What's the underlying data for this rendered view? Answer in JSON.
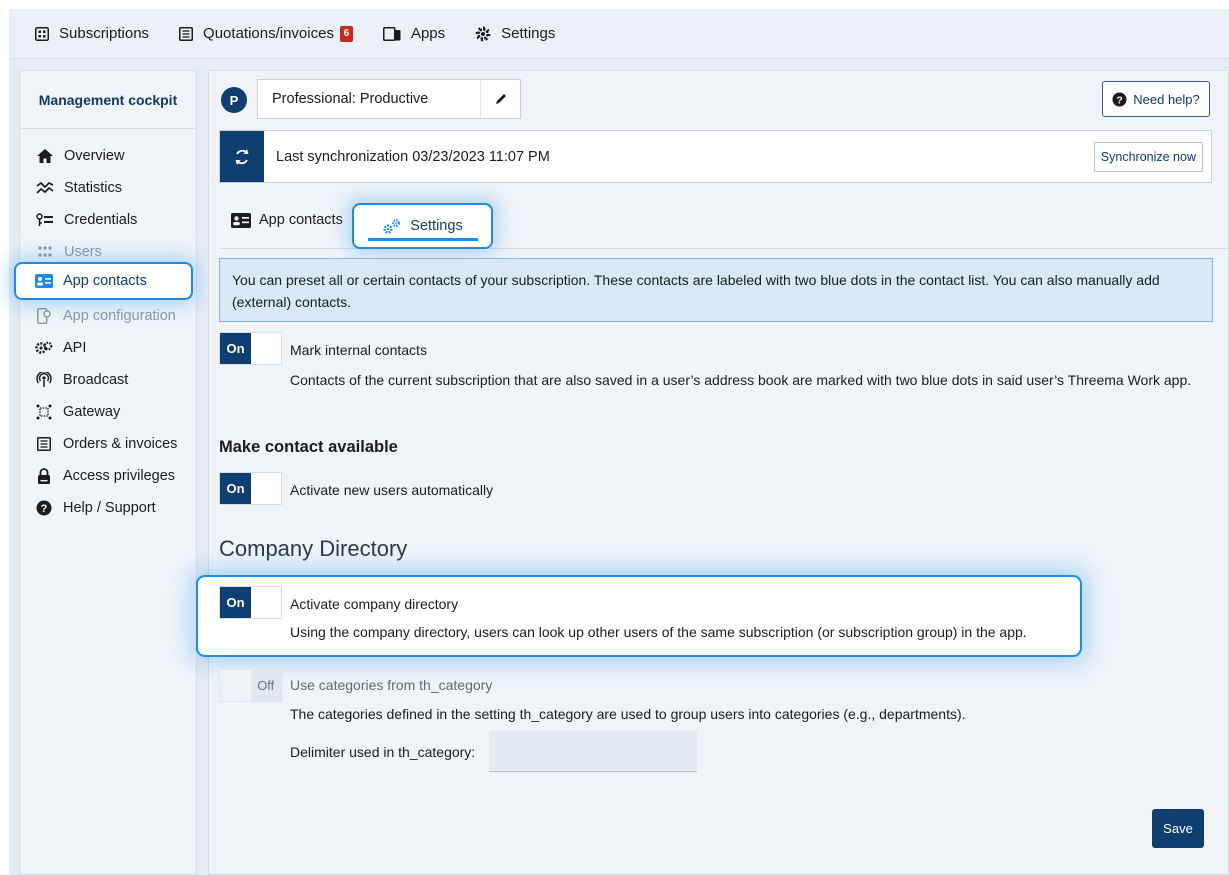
{
  "topnav": {
    "items": [
      {
        "label": "Subscriptions",
        "icon": "grid-icon"
      },
      {
        "label": "Quotations/invoices",
        "icon": "invoice-icon",
        "badge": "6"
      },
      {
        "label": "Apps",
        "icon": "apps-icon"
      },
      {
        "label": "Settings",
        "icon": "gear-icon"
      }
    ]
  },
  "sidebar": {
    "title": "Management cockpit",
    "items": [
      {
        "label": "Overview",
        "icon": "home-icon"
      },
      {
        "label": "Statistics",
        "icon": "chart-icon"
      },
      {
        "label": "Credentials",
        "icon": "key-icon"
      },
      {
        "label": "Users",
        "icon": "users-icon",
        "disabled": true
      },
      {
        "label": "App contacts",
        "icon": "contacts-icon",
        "active": true
      },
      {
        "label": "App configuration",
        "icon": "app-config-icon",
        "disabled": true
      },
      {
        "label": "API",
        "icon": "api-icon"
      },
      {
        "label": "Broadcast",
        "icon": "broadcast-icon"
      },
      {
        "label": "Gateway",
        "icon": "gateway-icon"
      },
      {
        "label": "Orders & invoices",
        "icon": "orders-icon"
      },
      {
        "label": "Access privileges",
        "icon": "lock-icon"
      },
      {
        "label": "Help / Support",
        "icon": "help-icon"
      }
    ]
  },
  "header": {
    "profile_initial": "P",
    "profile_name": "Professional: Productive",
    "help_label": "Need help?",
    "sync_text": "Last synchronization 03/23/2023 11:07 PM",
    "sync_button": "Synchronize now"
  },
  "tabs": {
    "app_contacts": "App contacts",
    "settings": "Settings"
  },
  "info": {
    "text": "You can preset all or certain contacts of your subscription. These contacts are labeled with two blue dots in the contact list. You can also manually add (external) contacts."
  },
  "settings": {
    "mark_internal": {
      "state": "On",
      "label": "Mark internal contacts",
      "desc": "Contacts of the current subscription that are also saved in a user’s address book are marked with two blue dots in said user’s Threema Work app."
    },
    "make_available_heading": "Make contact available",
    "activate_new": {
      "state": "On",
      "label": "Activate new users automatically"
    },
    "company_directory_heading": "Company Directory",
    "activate_directory": {
      "state": "On",
      "label": "Activate company directory",
      "desc": "Using the company directory, users can look up other users of the same subscription (or subscription group) in the app."
    },
    "use_categories": {
      "state": "Off",
      "label": "Use categories from th_category",
      "desc": "The categories defined in the setting th_category are used to group users into categories (e.g., departments)."
    },
    "delimiter_label": "Delimiter used in th_category:",
    "delimiter_value": ""
  },
  "save_label": "Save",
  "colors": {
    "primary": "#0f3f70",
    "highlight": "#1a8cf0",
    "badge": "#c8281e",
    "info_bg": "#d8e8f6"
  }
}
